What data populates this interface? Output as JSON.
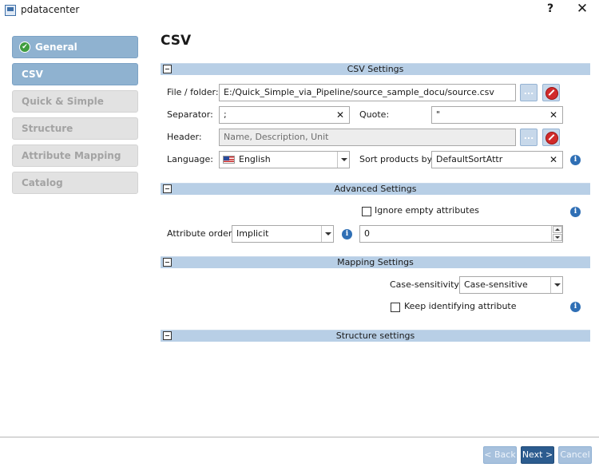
{
  "window": {
    "title": "pdatacenter",
    "help_label": "?",
    "close_label": "✕"
  },
  "sidebar": {
    "items": [
      {
        "label": "General",
        "state": "done"
      },
      {
        "label": "CSV",
        "state": "active"
      },
      {
        "label": "Quick & Simple",
        "state": "disabled"
      },
      {
        "label": "Structure",
        "state": "disabled"
      },
      {
        "label": "Attribute Mapping",
        "state": "disabled"
      },
      {
        "label": "Catalog",
        "state": "disabled"
      }
    ]
  },
  "page": {
    "title": "CSV"
  },
  "csv_settings": {
    "header": "CSV Settings",
    "file_label": "File / folder:",
    "file_value": "E:/Quick_Simple_via_Pipeline/source_sample_docu/source.csv",
    "browse_label": "...",
    "separator_label": "Separator:",
    "separator_value": ";",
    "quote_label": "Quote:",
    "quote_value": "\"",
    "header_label": "Header:",
    "header_value": "Name, Description, Unit",
    "language_label": "Language:",
    "language_value": "English",
    "sort_label": "Sort products by:",
    "sort_value": "DefaultSortAttr",
    "clear_glyph": "✕"
  },
  "advanced_settings": {
    "header": "Advanced Settings",
    "ignore_empty_label": "Ignore empty attributes",
    "ignore_empty_checked": false,
    "attribute_order_label": "Attribute order:",
    "attribute_order_value": "Implicit",
    "order_number_value": "0"
  },
  "mapping_settings": {
    "header": "Mapping Settings",
    "case_label": "Case-sensitivity:",
    "case_value": "Case-sensitive",
    "keep_identifying_label": "Keep identifying attribute",
    "keep_identifying_checked": false
  },
  "structure_settings": {
    "header": "Structure settings"
  },
  "footer": {
    "back_label": "< Back",
    "next_label": "Next >",
    "cancel_label": "Cancel"
  },
  "info_glyph": "i",
  "colors": {
    "section_header": "#b8cfe6",
    "nav_active": "#8fb2d0",
    "primary_button": "#2c5c8f",
    "stop_red": "#d12b2b"
  }
}
